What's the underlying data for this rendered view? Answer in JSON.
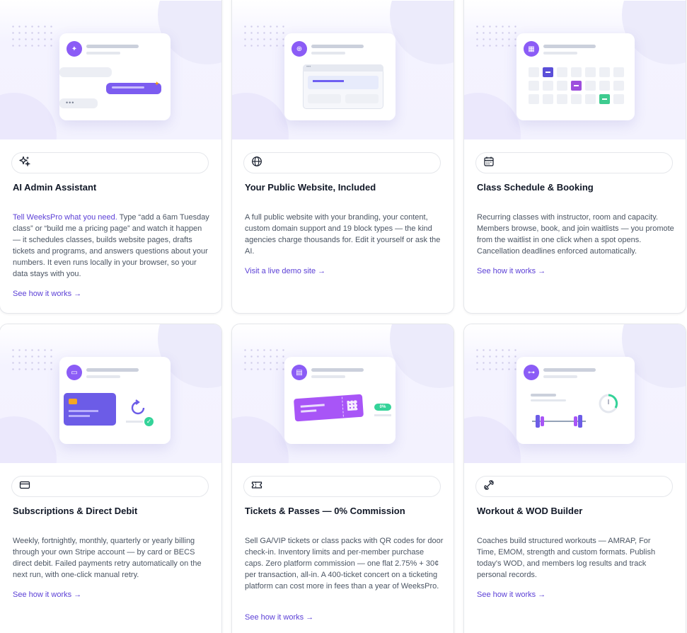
{
  "cards": [
    {
      "icon": "sparkles-icon",
      "title": "AI Admin Assistant",
      "desc_highlight": "Tell WeeksPro what you need.",
      "desc": " Type “add a 6am Tuesday class” or “build me a pricing page” and watch it happen — it schedules classes, builds website pages, drafts tickets and programs, and answers questions about your numbers. It even runs locally in your browser, so your data stays with you.",
      "link": "See how it works →"
    },
    {
      "icon": "globe-icon",
      "title": "Your Public Website, Included",
      "desc": "A full public website with your branding, your content, custom domain support and 19 block types — the kind agencies charge thousands for. Edit it yourself or ask the AI.",
      "link": "Visit a live demo site →"
    },
    {
      "icon": "calendar-icon",
      "title": "Class Schedule & Booking",
      "desc": "Recurring classes with instructor, room and capacity. Members browse, book, and join waitlists — you promote from the waitlist in one click when a spot opens. Cancellation deadlines enforced automatically.",
      "link": "See how it works →"
    },
    {
      "icon": "credit-card-icon",
      "title": "Subscriptions & Direct Debit",
      "desc": "Weekly, fortnightly, monthly, quarterly or yearly billing through your own Stripe account — by card or BECS direct debit. Failed payments retry automatically on the next run, with one-click manual retry.",
      "link": "See how it works →"
    },
    {
      "icon": "ticket-icon",
      "title": "Tickets & Passes — 0% Commission",
      "desc": "Sell GA/VIP tickets or class packs with QR codes for door check-in. Inventory limits and per-member purchase caps. Zero platform commission — one flat 2.75% + 30¢ per transaction, all-in. A 400-ticket concert on a ticketing platform can cost more in fees than a year of WeeksPro.",
      "badge": "0%",
      "link": "See how it works →"
    },
    {
      "icon": "dumbbell-icon",
      "title": "Workout & WOD Builder",
      "desc": "Coaches build structured workouts — AMRAP, For Time, EMOM, strength and custom formats. Publish today's WOD, and members log results and track personal records.",
      "link": "See how it works →"
    }
  ],
  "colors": {
    "accent": "#5b3fd6",
    "violet": "#8b5cf6",
    "green": "#34d399"
  }
}
